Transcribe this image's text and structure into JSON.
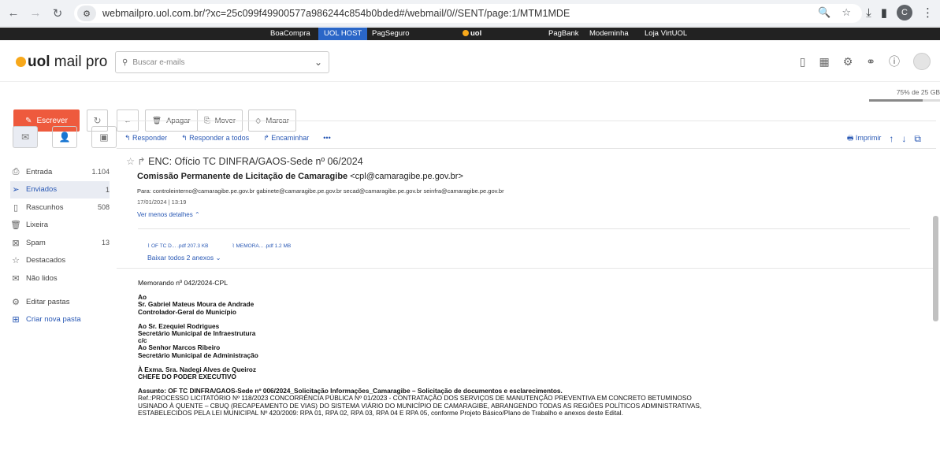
{
  "browser": {
    "url": "webmailpro.uol.com.br/?xc=25c099f49900577a986244c854b0bded#/webmail/0//SENT/page:1/MTM1MDE",
    "profile_initial": "C"
  },
  "uolbar": {
    "links": [
      "BoaCompra",
      "UOL HOST",
      "PagSeguro",
      "uol",
      "PagBank",
      "Modeminha",
      "Loja VirtUOL"
    ]
  },
  "header": {
    "brand_bold": "uol",
    "brand_rest": "mail pro",
    "search_placeholder": "Buscar e-mails"
  },
  "toolbar": {
    "compose": "Escrever",
    "delete": "Apagar",
    "move": "Mover",
    "mark": "Marcar",
    "quota_text": "75% de 25 GB",
    "quota_fraction": 0.75
  },
  "folders": [
    {
      "label": "Entrada",
      "count": "1.104",
      "icon": "inbox-icon"
    },
    {
      "label": "Enviados",
      "count": "1",
      "icon": "send-icon",
      "active": true
    },
    {
      "label": "Rascunhos",
      "count": "508",
      "icon": "draft-icon"
    },
    {
      "label": "Lixeira",
      "count": "",
      "icon": "trash-icon"
    },
    {
      "label": "Spam",
      "count": "13",
      "icon": "spam-icon"
    },
    {
      "label": "Destacados",
      "count": "",
      "icon": "star-icon"
    },
    {
      "label": "Não lidos",
      "count": "",
      "icon": "unread-icon"
    }
  ],
  "folder_actions": {
    "edit": "Editar pastas",
    "create": "Criar nova pasta"
  },
  "mail_actions": {
    "reply": "Responder",
    "reply_all": "Responder a todos",
    "forward": "Encaminhar",
    "more": "•••",
    "print": "Imprimir"
  },
  "message": {
    "subject": "ENC: Ofício TC DINFRA/GAOS-Sede nº 06/2024",
    "from_name": "Comissão Permanente de Licitação de Camaragibe",
    "from_email": "<cpl@camaragibe.pe.gov.br>",
    "to_label": "Para:",
    "to": "controleinterno@camaragibe.pe.gov.br gabinete@camaragibe.pe.gov.br secad@camaragibe.pe.gov.br seinfra@camaragibe.pe.gov.br",
    "date": "17/01/2024 | 13:19",
    "less_details": "Ver menos detalhes",
    "attachments": [
      {
        "name": "OF TC D... .pdf",
        "size": "207.3 KB"
      },
      {
        "name": "MEMORA... .pdf",
        "size": "1.2 MB"
      }
    ],
    "download_all": "Baixar todos 2 anexos"
  },
  "body": {
    "memo": "Memorando nº 042/2024-CPL",
    "ao": "Ao",
    "recipient1": "Sr. Gabriel Mateus Moura de Andrade",
    "role1": "Controlador-Geral do Município",
    "recipient2": "Ao Sr. Ezequiel Rodrigues",
    "role2": "Secretário Municipal de Infraestrutura",
    "cc": "c/c",
    "recipient3": "Ao Senhor Marcos Ribeiro",
    "role3": "Secretário Municipal de Administração",
    "recipient4": "À Exma. Sra. Nadegi Alves de Queiroz",
    "role4": "CHEFE DO PODER EXECUTIVO",
    "assunto": "Assunto: OF TC DINFRA/GAOS-Sede nº 006/2024_Solicitação Informações_Camaragibe – Solicitação de documentos e esclarecimentos.",
    "ref1": "Ref.:PROCESSO LICITATÓRIO Nº 118/2023 CONCORRÊNCIA PÚBLICA Nº 01/2023 - CONTRATAÇÃO DOS SERVIÇOS DE MANUTENÇÃO PREVENTIVA EM CONCRETO BETUMINOSO",
    "ref2": "USINADO À QUENTE – CBUQ (RECAPEAMENTO DE VIAS) DO SISTEMA VIÁRIO DO MUNICÍPIO DE CAMARAGIBE, ABRANGENDO TODAS AS REGIÕES POLÍTICOS ADMINISTRATIVAS,",
    "ref3": "ESTABELECIDOS PELA LEI MUNICIPAL Nº 420/2009: RPA 01, RPA 02, RPA 03, RPA 04 E RPA 05, conforme Projeto Básico/Plano de Trabalho e anexos deste Edital."
  }
}
